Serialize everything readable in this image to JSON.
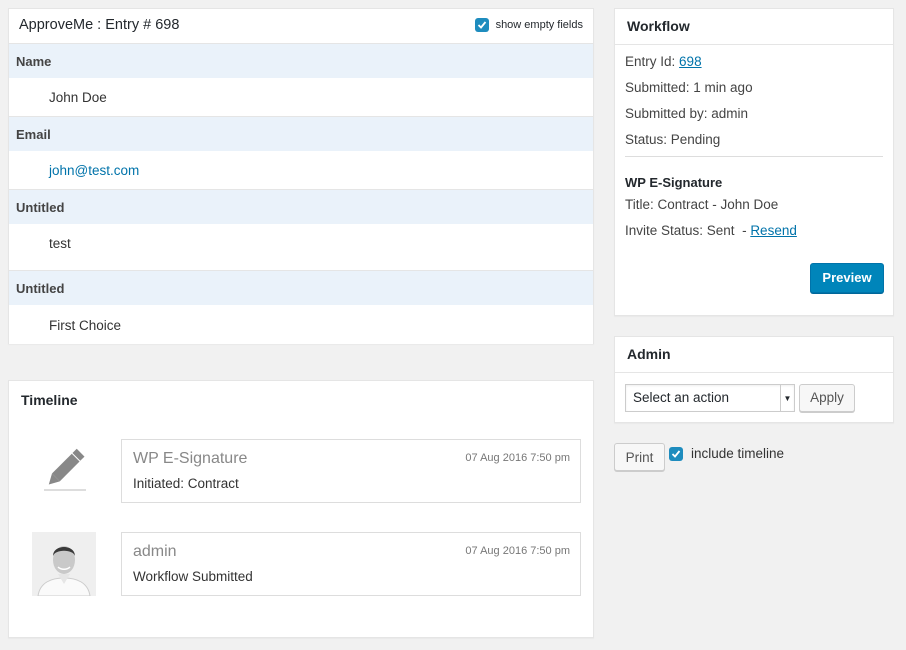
{
  "entry": {
    "title": "ApproveMe : Entry # 698",
    "show_empty_label": "show empty fields",
    "fields": [
      {
        "label": "Name",
        "value": "John Doe"
      },
      {
        "label": "Email",
        "value": "john@test.com"
      },
      {
        "label": "Untitled",
        "value": "test"
      },
      {
        "label": "Untitled",
        "value": "First Choice"
      }
    ]
  },
  "workflow": {
    "title": "Workflow",
    "entry_id_label": "Entry Id:",
    "entry_id": "698",
    "submitted": "Submitted: 1 min ago",
    "submitted_by": "Submitted by: admin",
    "status": "Status: Pending",
    "esig_title": "WP E-Signature",
    "doc_title": "Title: Contract - John Doe",
    "invite_status": "Invite Status: Sent",
    "resend": "Resend",
    "preview": "Preview"
  },
  "admin": {
    "title": "Admin",
    "select_value": "Select an action",
    "apply": "Apply"
  },
  "print": {
    "button": "Print",
    "include_label": "include timeline"
  },
  "timeline": {
    "title": "Timeline",
    "items": [
      {
        "who": "WP E-Signature",
        "when": "07 Aug 2016 7:50 pm",
        "what": "Initiated: Contract",
        "icon": "pencil-icon"
      },
      {
        "who": "admin",
        "when": "07 Aug 2016 7:50 pm",
        "what": "Workflow Submitted",
        "icon": "avatar"
      }
    ]
  },
  "colors": {
    "accent": "#0085ba",
    "link": "#0073aa",
    "field_label_bg": "#eaf2fa"
  }
}
